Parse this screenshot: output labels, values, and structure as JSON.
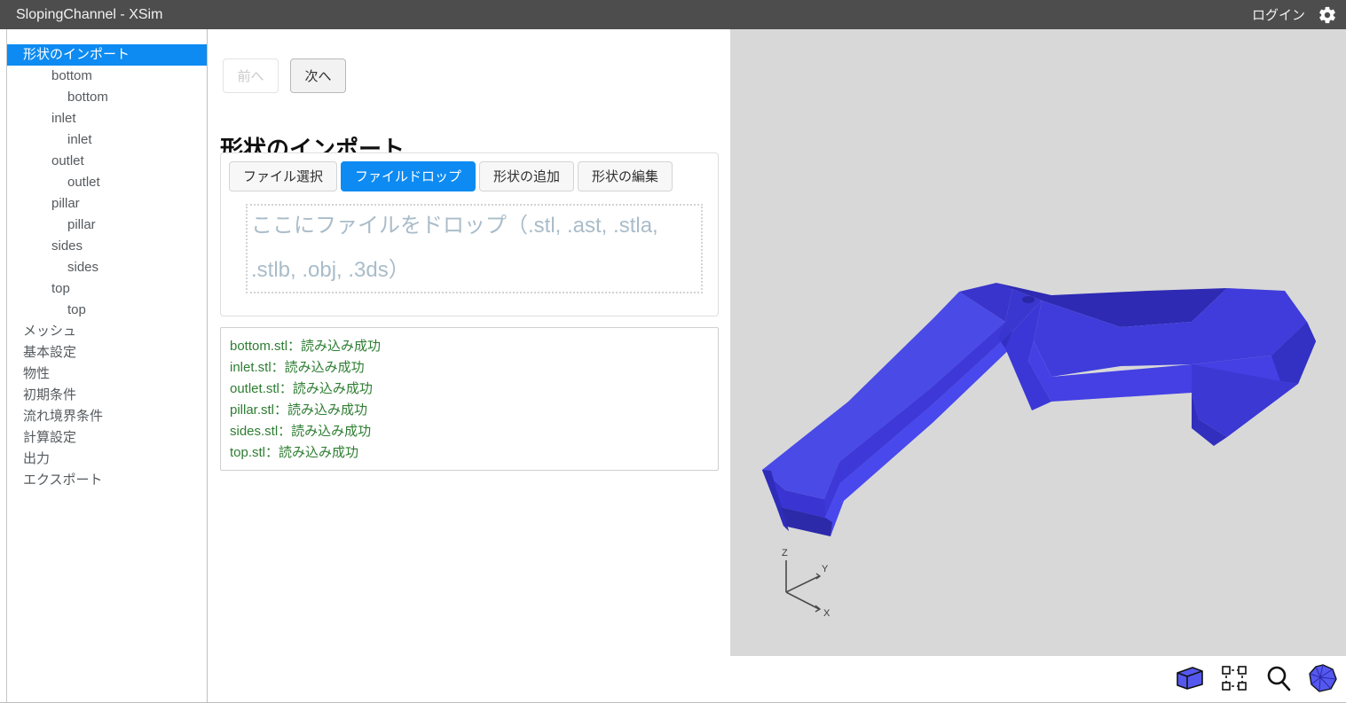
{
  "titlebar": {
    "title": "SlopingChannel - XSim",
    "login_label": "ログイン",
    "gear_icon": "gear-icon"
  },
  "sidebar": {
    "items": [
      {
        "label": "形状のインポート",
        "depth": 0,
        "selected": true
      },
      {
        "label": "bottom",
        "depth": 1,
        "selected": false
      },
      {
        "label": "bottom",
        "depth": 2,
        "selected": false
      },
      {
        "label": "inlet",
        "depth": 1,
        "selected": false
      },
      {
        "label": "inlet",
        "depth": 2,
        "selected": false
      },
      {
        "label": "outlet",
        "depth": 1,
        "selected": false
      },
      {
        "label": "outlet",
        "depth": 2,
        "selected": false
      },
      {
        "label": "pillar",
        "depth": 1,
        "selected": false
      },
      {
        "label": "pillar",
        "depth": 2,
        "selected": false
      },
      {
        "label": "sides",
        "depth": 1,
        "selected": false
      },
      {
        "label": "sides",
        "depth": 2,
        "selected": false
      },
      {
        "label": "top",
        "depth": 1,
        "selected": false
      },
      {
        "label": "top",
        "depth": 2,
        "selected": false
      },
      {
        "label": "メッシュ",
        "depth": 0,
        "selected": false
      },
      {
        "label": "基本設定",
        "depth": 0,
        "selected": false
      },
      {
        "label": "物性",
        "depth": 0,
        "selected": false
      },
      {
        "label": "初期条件",
        "depth": 0,
        "selected": false
      },
      {
        "label": "流れ境界条件",
        "depth": 0,
        "selected": false
      },
      {
        "label": "計算設定",
        "depth": 0,
        "selected": false
      },
      {
        "label": "出力",
        "depth": 0,
        "selected": false
      },
      {
        "label": "エクスポート",
        "depth": 0,
        "selected": false
      }
    ]
  },
  "main": {
    "prev_label": "前へ",
    "next_label": "次へ",
    "page_title": "形状のインポート",
    "tabs": [
      {
        "label": "ファイル選択",
        "active": false
      },
      {
        "label": "ファイルドロップ",
        "active": true
      },
      {
        "label": "形状の追加",
        "active": false
      },
      {
        "label": "形状の編集",
        "active": false
      }
    ],
    "dropzone_text": "ここにファイルをドロップ（.stl, .ast, .stla, .stlb, .obj, .3ds）",
    "log_lines": [
      "bottom.stl：読み込み成功",
      "inlet.stl：読み込み成功",
      "outlet.stl：読み込み成功",
      "pillar.stl：読み込み成功",
      "sides.stl：読み込み成功",
      "top.stl：読み込み成功"
    ]
  },
  "viewport": {
    "axis_labels": {
      "x": "X",
      "y": "Y",
      "z": "Z"
    },
    "tools": [
      {
        "name": "shape-view-icon"
      },
      {
        "name": "select-box-icon"
      },
      {
        "name": "zoom-icon"
      },
      {
        "name": "orientation-cube-icon"
      }
    ]
  },
  "colors": {
    "titlebar_bg": "#4d4d4d",
    "accent_blue": "#0d8bf2",
    "model_blue": "#3a3ad6",
    "viewport_bg": "#d8d8d8",
    "log_green": "#2e7d32",
    "dropzone_text": "#a9bcc9"
  }
}
